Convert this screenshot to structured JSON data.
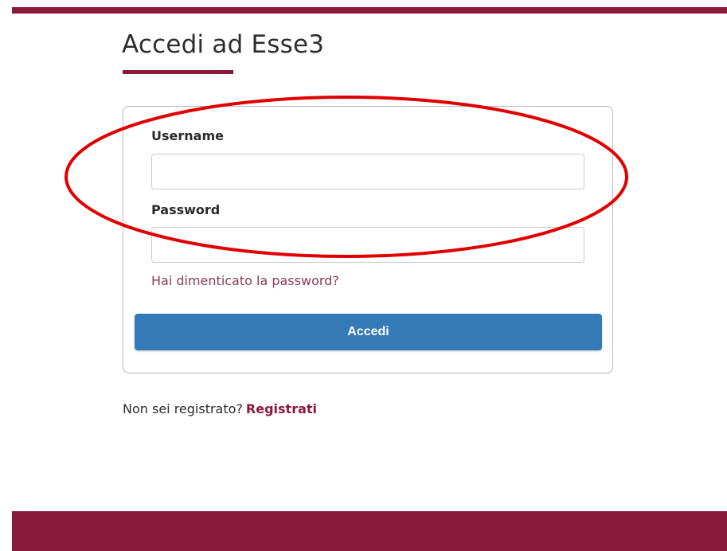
{
  "page": {
    "title": "Accedi ad Esse3"
  },
  "form": {
    "username_label": "Username",
    "username_value": "",
    "password_label": "Password",
    "password_value": "",
    "forgot_password": "Hai dimenticato la password?",
    "submit_label": "Accedi"
  },
  "register": {
    "prompt": "Non sei registrato?",
    "link_label": "Registrati"
  },
  "colors": {
    "brand": "#8a1a3c",
    "button": "#337ab7",
    "annotation": "#e00000"
  }
}
